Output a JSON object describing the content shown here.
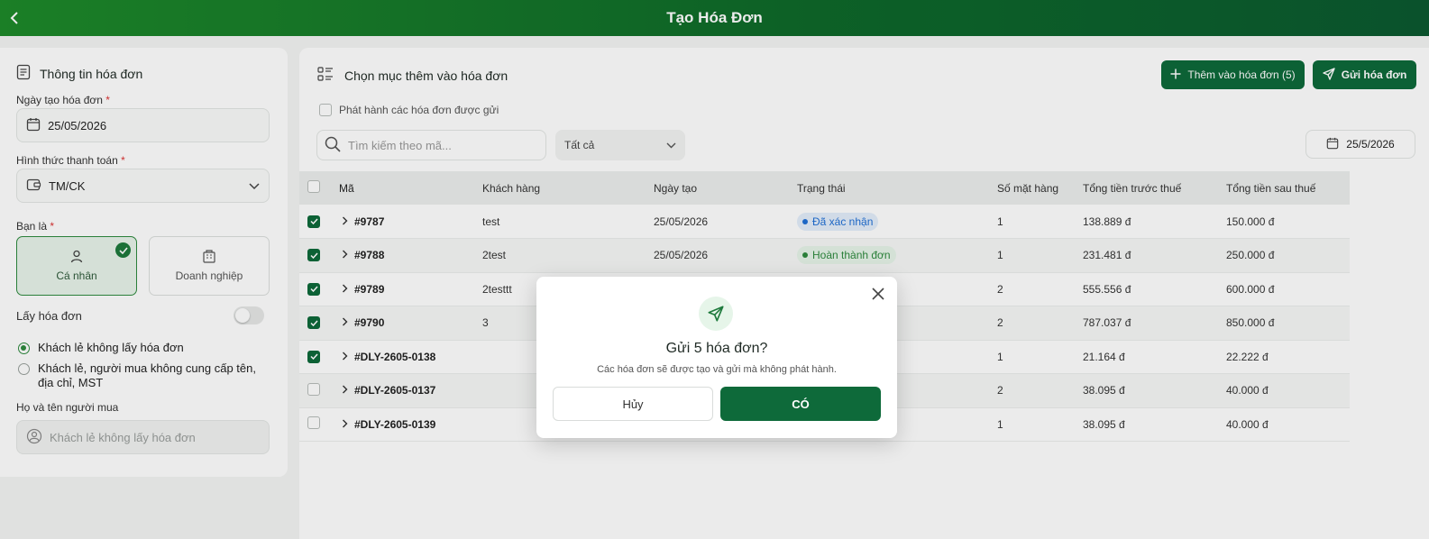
{
  "header": {
    "title": "Tạo Hóa Đơn"
  },
  "left": {
    "heading": "Thông tin hóa đơn",
    "date_label": "Ngày tạo hóa đơn",
    "date_value": "25/05/2026",
    "payment_label": "Hình thức thanh toán",
    "payment_value": "TM/CK",
    "role_label": "Bạn là",
    "role_individual": "Cá nhân",
    "role_business": "Doanh nghiệp",
    "invoice_toggle_label": "Lấy hóa đơn",
    "radio_1": "Khách lẻ không lấy hóa đơn",
    "radio_2": "Khách lẻ, người mua không cung cấp tên, địa chỉ, MST",
    "buyer_label": "Họ và tên người mua",
    "buyer_placeholder": "Khách lẻ không lấy hóa đơn",
    "required_mark": "*"
  },
  "main": {
    "heading": "Chọn mục thêm vào hóa đơn",
    "add_button": "Thêm vào hóa đơn (5)",
    "send_button": "Gửi hóa đơn",
    "issue_label": "Phát hành các hóa đơn được gửi",
    "search_placeholder": "Tìm kiếm theo mã...",
    "status_filter": "Tất cả",
    "date_filter": "25/5/2026",
    "columns": [
      "Mã",
      "Khách hàng",
      "Ngày tạo",
      "Trạng thái",
      "Số mặt hàng",
      "Tổng tiền trước thuế",
      "Tổng tiền sau thuế"
    ],
    "rows": [
      {
        "checked": true,
        "code": "#9787",
        "customer": "test",
        "date": "25/05/2026",
        "status": "Đã xác nhận",
        "status_color": "#1f6fd6",
        "status_bg": "#e3eefb",
        "qty": "1",
        "pre_tax": "138.889 đ",
        "post_tax": "150.000 đ"
      },
      {
        "checked": true,
        "code": "#9788",
        "customer": "2test",
        "date": "25/05/2026",
        "status": "Hoàn thành đơn",
        "status_color": "#2e8a3e",
        "status_bg": "#e6f5e9",
        "qty": "1",
        "pre_tax": "231.481 đ",
        "post_tax": "250.000 đ"
      },
      {
        "checked": true,
        "code": "#9789",
        "customer": "2testtt",
        "date": "",
        "status": "",
        "status_color": "",
        "status_bg": "",
        "qty": "2",
        "pre_tax": "555.556 đ",
        "post_tax": "600.000 đ"
      },
      {
        "checked": true,
        "code": "#9790",
        "customer": "3",
        "date": "",
        "status": "",
        "status_color": "",
        "status_bg": "",
        "qty": "2",
        "pre_tax": "787.037 đ",
        "post_tax": "850.000 đ"
      },
      {
        "checked": true,
        "code": "#DLY-2605-0138",
        "customer": "",
        "date": "",
        "status": "",
        "status_color": "",
        "status_bg": "",
        "qty": "1",
        "pre_tax": "21.164 đ",
        "post_tax": "22.222 đ"
      },
      {
        "checked": false,
        "code": "#DLY-2605-0137",
        "customer": "",
        "date": "",
        "status": "",
        "status_color": "",
        "status_bg": "",
        "qty": "2",
        "pre_tax": "38.095 đ",
        "post_tax": "40.000 đ"
      },
      {
        "checked": false,
        "code": "#DLY-2605-0139",
        "customer": "",
        "date": "",
        "status": "",
        "status_color": "",
        "status_bg": "",
        "qty": "1",
        "pre_tax": "38.095 đ",
        "post_tax": "40.000 đ"
      }
    ]
  },
  "modal": {
    "title": "Gửi 5 hóa đơn?",
    "subtitle": "Các hóa đơn sẽ được tạo và gửi mà không phát hành.",
    "cancel": "Hủy",
    "confirm": "CÓ"
  },
  "colors": {
    "primary": "#0e6a3a",
    "accent": "#2e8a3e"
  }
}
